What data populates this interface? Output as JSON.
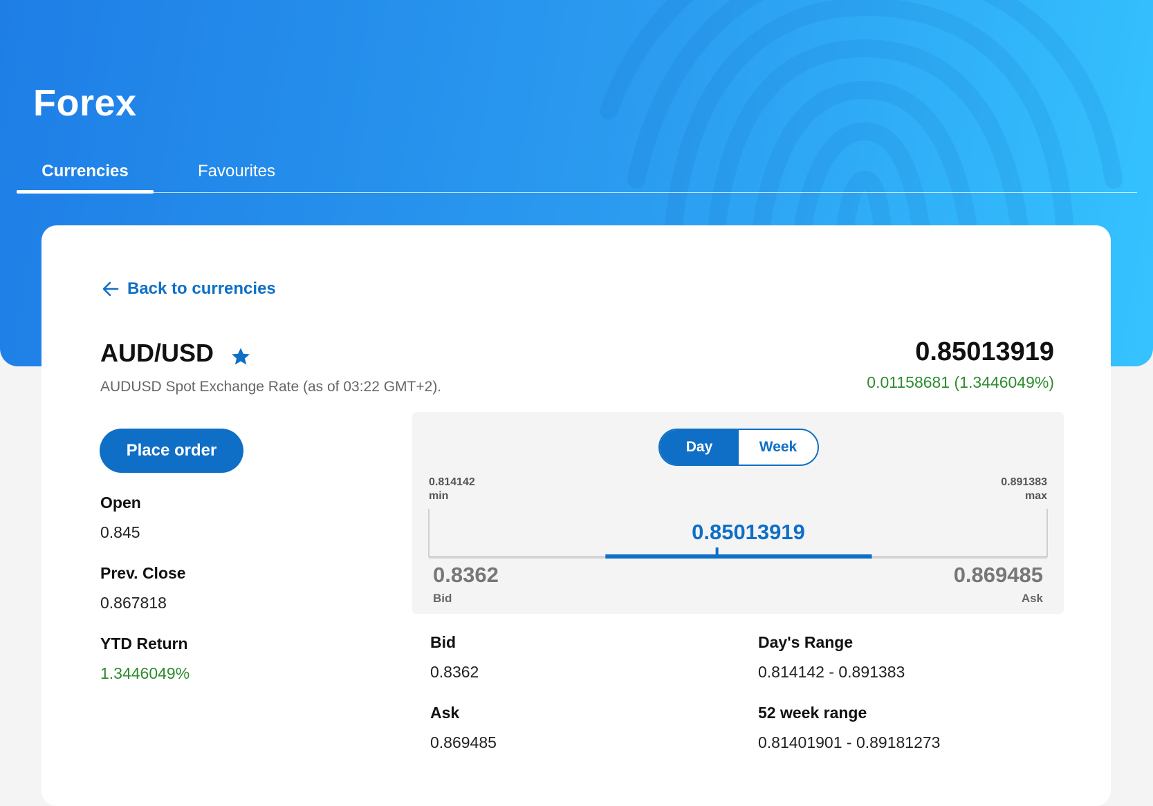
{
  "header": {
    "title": "Forex",
    "tabs": [
      {
        "label": "Currencies",
        "active": true
      },
      {
        "label": "Favourites",
        "active": false
      }
    ]
  },
  "detail": {
    "back_label": "Back to currencies",
    "pair": "AUD/USD",
    "favourite_icon": "star-icon",
    "subtitle": "AUDUSD Spot Exchange Rate (as of 03:22 GMT+2).",
    "price": "0.85013919",
    "change": "0.01158681 (1.3446049%)",
    "place_order_label": "Place order",
    "stats_left": [
      {
        "label": "Open",
        "value": "0.845"
      },
      {
        "label": "Prev. Close",
        "value": "0.867818"
      },
      {
        "label": "YTD Return",
        "value": "1.3446049%"
      }
    ],
    "stats_right": [
      {
        "label": "Bid",
        "value": "0.8362"
      },
      {
        "label": "Day's Range",
        "value": "0.814142 - 0.891383"
      },
      {
        "label": "Ask",
        "value": "0.869485"
      },
      {
        "label": "52 week range",
        "value": "0.81401901 - 0.89181273"
      }
    ]
  },
  "range_widget": {
    "toggle": [
      {
        "label": "Day",
        "selected": true
      },
      {
        "label": "Week",
        "selected": false
      }
    ],
    "min_value": "0.814142",
    "min_label": "min",
    "max_value": "0.891383",
    "max_label": "max",
    "current": "0.85013919",
    "bid_value": "0.8362",
    "bid_label": "Bid",
    "ask_value": "0.869485",
    "ask_label": "Ask",
    "range_min": 0.814142,
    "range_max": 0.891383,
    "bid": 0.8362,
    "ask": 0.869485,
    "current_num": 0.85013919
  },
  "colors": {
    "accent": "#0f6fc6",
    "positive": "#2e8b2e",
    "hero_start": "#1e7ee6",
    "hero_end": "#35c3ff"
  }
}
